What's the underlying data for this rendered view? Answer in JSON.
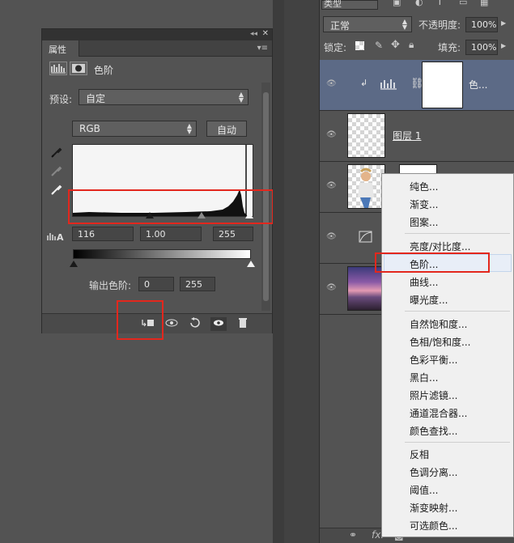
{
  "properties_panel": {
    "tab_label": "属性",
    "collapse_glyph": "◂◂",
    "close_glyph": "✕",
    "panel_menu_glyph": "▾≡",
    "adjustment_title": "色阶",
    "preset_label": "预设:",
    "preset_value": "自定",
    "channel_value": "RGB",
    "auto_label": "自动",
    "input_black": "116",
    "input_gamma": "1.00",
    "input_white": "255",
    "output_label": "输出色阶:",
    "output_black": "0",
    "output_white": "255"
  },
  "layers_panel": {
    "filter_kind": "类型",
    "blend_mode": "正常",
    "opacity_label": "不透明度:",
    "opacity_value": "100%",
    "lock_label": "锁定:",
    "fill_label": "填充:",
    "fill_value": "100%",
    "layers": [
      {
        "name": "色..."
      },
      {
        "name": "图层 1"
      },
      {
        "name": ""
      },
      {
        "name": ""
      },
      {
        "name": ""
      }
    ],
    "fx_label": "fx."
  },
  "context_menu": {
    "groups": [
      [
        "纯色...",
        "渐变...",
        "图案..."
      ],
      [
        "亮度/对比度...",
        "色阶...",
        "曲线...",
        "曝光度..."
      ],
      [
        "自然饱和度...",
        "色相/饱和度...",
        "色彩平衡...",
        "黑白...",
        "照片滤镜...",
        "通道混合器...",
        "颜色查找..."
      ],
      [
        "反相",
        "色调分离...",
        "阈值...",
        "渐变映射...",
        "可选颜色..."
      ]
    ],
    "highlighted": "色阶..."
  },
  "colors": {
    "annotation_red": "#e3271d",
    "panel_bg": "#535353",
    "selected_layer": "#5c6a86"
  }
}
